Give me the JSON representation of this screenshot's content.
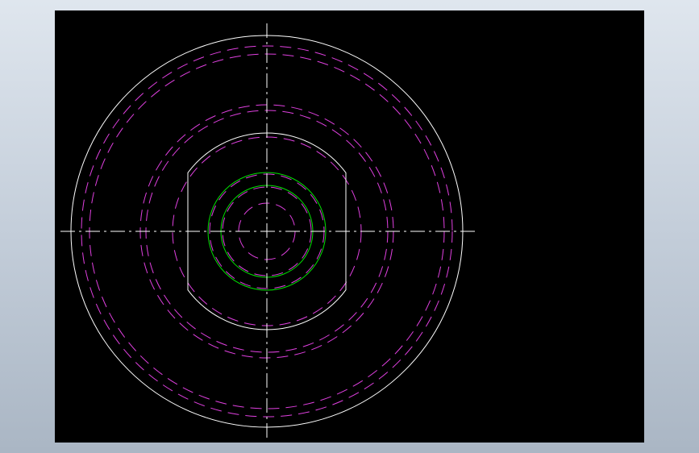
{
  "drawing": {
    "colors": {
      "background": "#000000",
      "outline": "#ffffff",
      "hidden": "#e040e0",
      "accent": "#00e000",
      "centerline": "#ffffff"
    },
    "circles": [
      {
        "name": "outer-circle",
        "r": 243,
        "style": "solid",
        "color": "outline"
      },
      {
        "name": "outer-hidden-circle-a",
        "r": 230,
        "style": "dashed",
        "color": "hidden"
      },
      {
        "name": "outer-hidden-circle-b",
        "r": 220,
        "style": "dashed",
        "color": "hidden"
      },
      {
        "name": "mid-hidden-circle-a",
        "r": 157,
        "style": "dashed",
        "color": "hidden"
      },
      {
        "name": "mid-hidden-circle-b",
        "r": 150,
        "style": "dashed",
        "color": "hidden"
      },
      {
        "name": "mid-hidden-circle-c",
        "r": 117,
        "style": "dashed",
        "color": "hidden"
      },
      {
        "name": "bore-green-circle",
        "r": 73,
        "style": "solid",
        "color": "accent"
      },
      {
        "name": "bore-hidden-circle",
        "r": 71,
        "style": "dashed",
        "color": "hidden"
      },
      {
        "name": "inner-green-circle",
        "r": 57,
        "style": "solid",
        "color": "accent"
      },
      {
        "name": "inner-hidden-circle",
        "r": 55,
        "style": "dashed",
        "color": "hidden"
      },
      {
        "name": "center-hidden-circle",
        "r": 35,
        "style": "dashed",
        "color": "hidden"
      }
    ],
    "flat_hub": {
      "r": 122,
      "flat_half_width": 98
    }
  }
}
